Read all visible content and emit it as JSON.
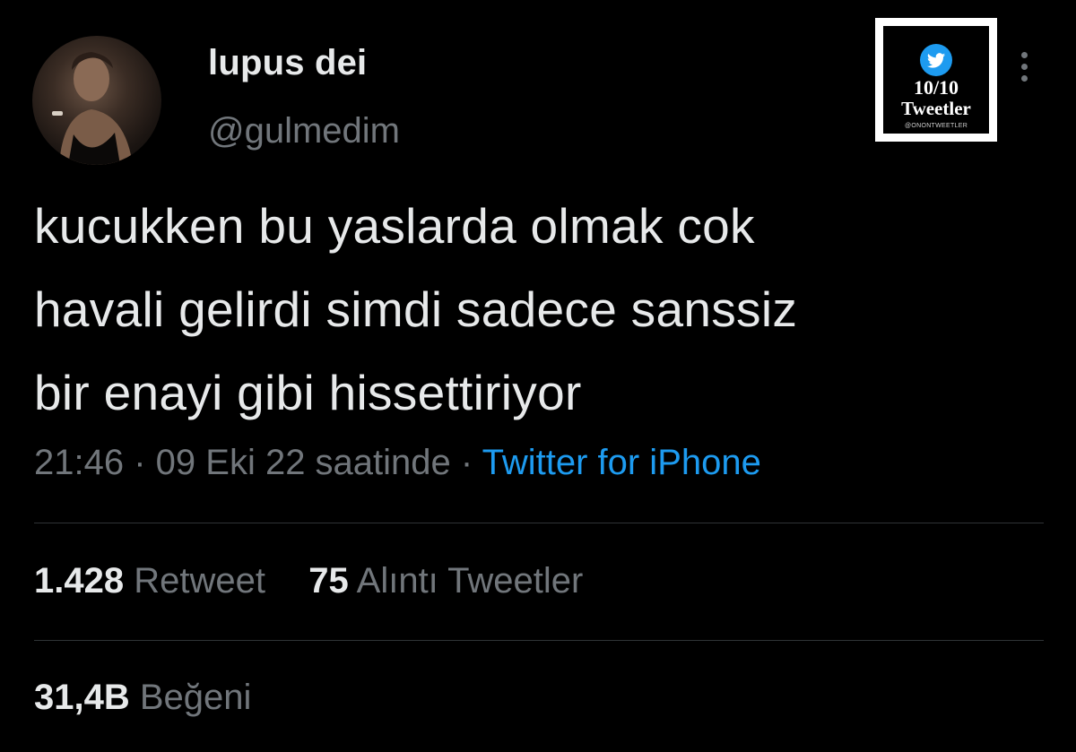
{
  "user": {
    "display_name": "lupus dei",
    "handle": "@gulmedim"
  },
  "badge": {
    "score": "10/10",
    "title": "Tweetler",
    "account": "@ONONTWEETLER"
  },
  "tweet": {
    "lines": [
      "kucukken bu yaslarda olmak cok",
      "havali gelirdi simdi sadece sanssiz",
      "bir enayi gibi hissettiriyor"
    ],
    "time": "21:46",
    "separator": " · ",
    "date": "09 Eki 22 saatinde",
    "source": "Twitter for iPhone"
  },
  "stats": {
    "retweets_count": "1.428",
    "retweets_label": "Retweet",
    "quotes_count": "75",
    "quotes_label": "Alıntı Tweetler",
    "likes_count": "31,4B",
    "likes_label": "Beğeni"
  },
  "colors": {
    "background": "#000000",
    "primary_text": "#e7e9ea",
    "secondary_text": "#71767b",
    "link": "#1d9bf0",
    "divider": "#2f3336"
  }
}
